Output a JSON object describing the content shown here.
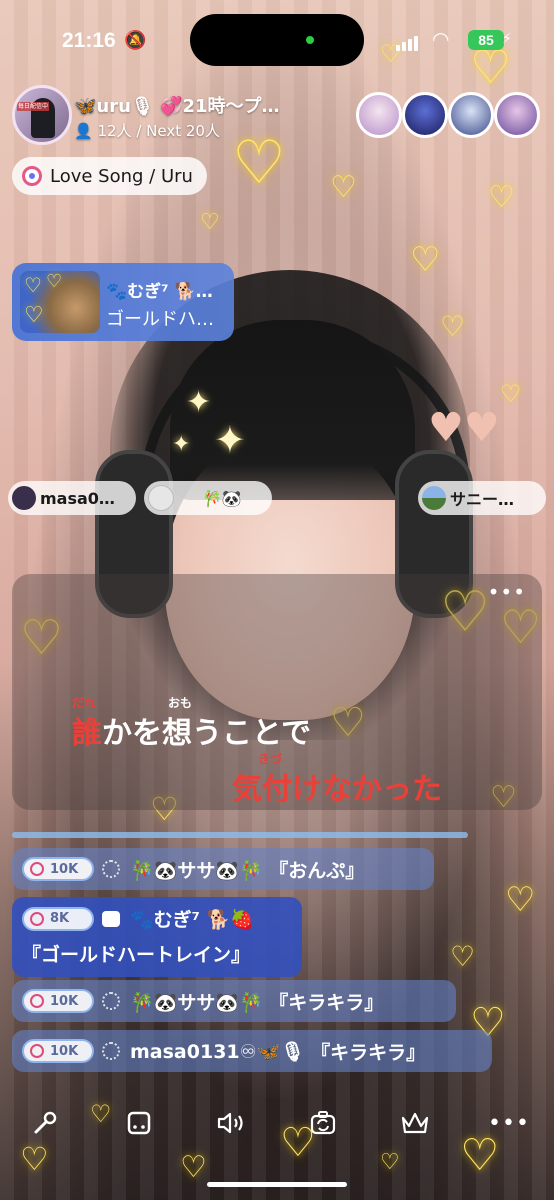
{
  "status_bar": {
    "time": "21:16",
    "battery": "85"
  },
  "host": {
    "title": "🦋uru🎙 💞21時〜プ…",
    "viewers": "12人 / Next 20人"
  },
  "song": {
    "title": "Love Song / Uru"
  },
  "gift_banner": {
    "user": "🐾むぎ⁷ 🐕…",
    "item": "ゴールドハ…"
  },
  "user_pills": [
    {
      "label": "masa0…"
    },
    {
      "label": "🎋🐼"
    },
    {
      "label": "サニー…"
    }
  ],
  "lyrics": {
    "more": "•••",
    "line1": {
      "ruby_1": "だれ",
      "ruby_2": "おも",
      "red_char": "誰",
      "rest": "かを想うことで"
    },
    "line2": {
      "ruby": "きづ",
      "text": "気付けなかった"
    }
  },
  "comments": [
    {
      "level": "10K",
      "user": "🎋🐼ササ🐼🎋",
      "message": "『おんぷ』"
    },
    {
      "level": "8K",
      "user": "🐾むぎ⁷ 🐕🍓",
      "message": "『ゴールドハートレイン』"
    },
    {
      "level": "10K",
      "user": "🎋🐼ササ🐼🎋",
      "message": "『キラキラ』"
    },
    {
      "level": "10K",
      "user": "masa0131♾🦋🎙",
      "message": "『キラキラ』"
    }
  ],
  "toolbar": {
    "more": "•••"
  },
  "icons": [
    "bell-slash-icon",
    "signal-icon",
    "wifi-icon",
    "battery-icon",
    "person-icon",
    "close-icon",
    "music-disc-icon",
    "microphone-icon",
    "dice-icon",
    "speaker-icon",
    "camera-flip-icon",
    "crown-icon",
    "more-icon"
  ]
}
